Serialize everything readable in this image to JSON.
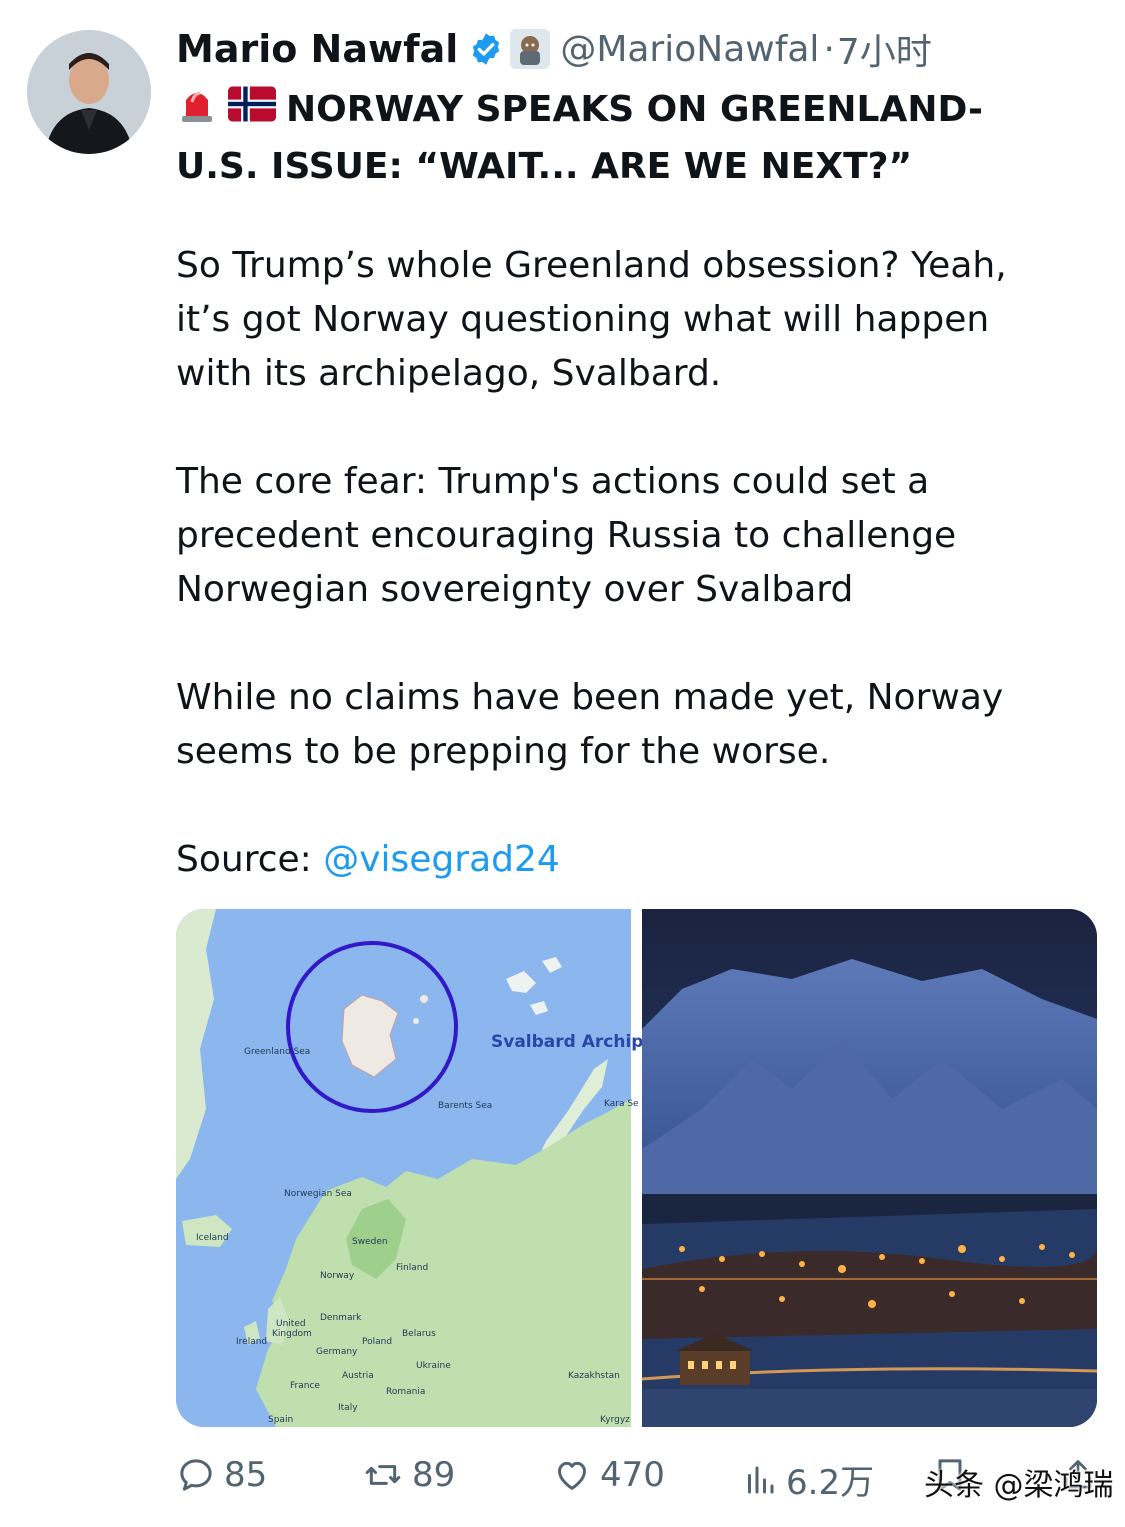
{
  "author": {
    "name": "Mario Nawfal",
    "handle": "@MarioNawfal",
    "separator": "·",
    "time": "7小时"
  },
  "tweet": {
    "headline_line1": "NORWAY SPEAKS ON GREENLAND-",
    "headline_line2": "U.S. ISSUE: “WAIT... ARE WE NEXT?”",
    "para1_line1": "So Trump’s whole Greenland obsession? Yeah,",
    "para1_line2": "it’s got Norway questioning what will happen",
    "para1_line3": "with its archipelago, Svalbard.",
    "para2_line1": "The core fear: Trump's actions could set a",
    "para2_line2": "precedent encouraging Russia to challenge",
    "para2_line3": "Norwegian sovereignty over Svalbard",
    "para3_line1": "While no claims have been made yet, Norway",
    "para3_line2": "seems to be prepping for the worse.",
    "source_label": "Source: ",
    "source_mention": "@visegrad24"
  },
  "map": {
    "svalbard_label": "Svalbard Archip",
    "greenland_sea": "Greenland Sea",
    "barents_sea": "Barents Sea",
    "kara_sea": "Kara Se",
    "norwegian_sea": "Norwegian Sea",
    "iceland": "Iceland",
    "sweden": "Sweden",
    "finland": "Finland",
    "norway": "Norway",
    "united_kingdom_1": "United",
    "united_kingdom_2": "Kingdom",
    "denmark": "Denmark",
    "ireland": "Ireland",
    "belarus": "Belarus",
    "poland": "Poland",
    "germany": "Germany",
    "ukraine": "Ukraine",
    "kazakhstan": "Kazakhstan",
    "austria": "Austria",
    "france": "France",
    "romania": "Romania",
    "italy": "Italy",
    "spain": "Spain",
    "kyrgyz": "Kyrgyz"
  },
  "actions": {
    "replies": "85",
    "reposts": "89",
    "likes": "470",
    "views": "6.2万"
  },
  "watermark": "头条 @梁鸿瑞",
  "colors": {
    "link": "#1d9bf0",
    "verified": "#1d9bf0",
    "muted": "#536471"
  }
}
